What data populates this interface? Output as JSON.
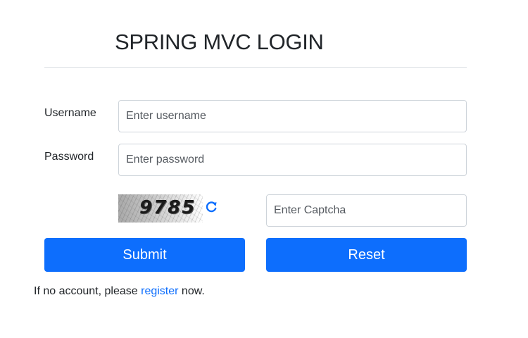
{
  "page": {
    "title": "SPRING MVC LOGIN"
  },
  "form": {
    "username_label": "Username",
    "username_placeholder": "Enter username",
    "username_value": "",
    "password_label": "Password",
    "password_placeholder": "Enter password",
    "password_value": "",
    "captcha_code": "9785",
    "captcha_placeholder": "Enter Captcha",
    "captcha_value": "",
    "submit_label": "Submit",
    "reset_label": "Reset"
  },
  "footer": {
    "prefix": "If no account, please ",
    "link_text": "register",
    "suffix": " now."
  },
  "colors": {
    "primary": "#0d6efd",
    "text": "#212529",
    "border": "#ced4da"
  },
  "icons": {
    "refresh": "refresh-icon"
  }
}
